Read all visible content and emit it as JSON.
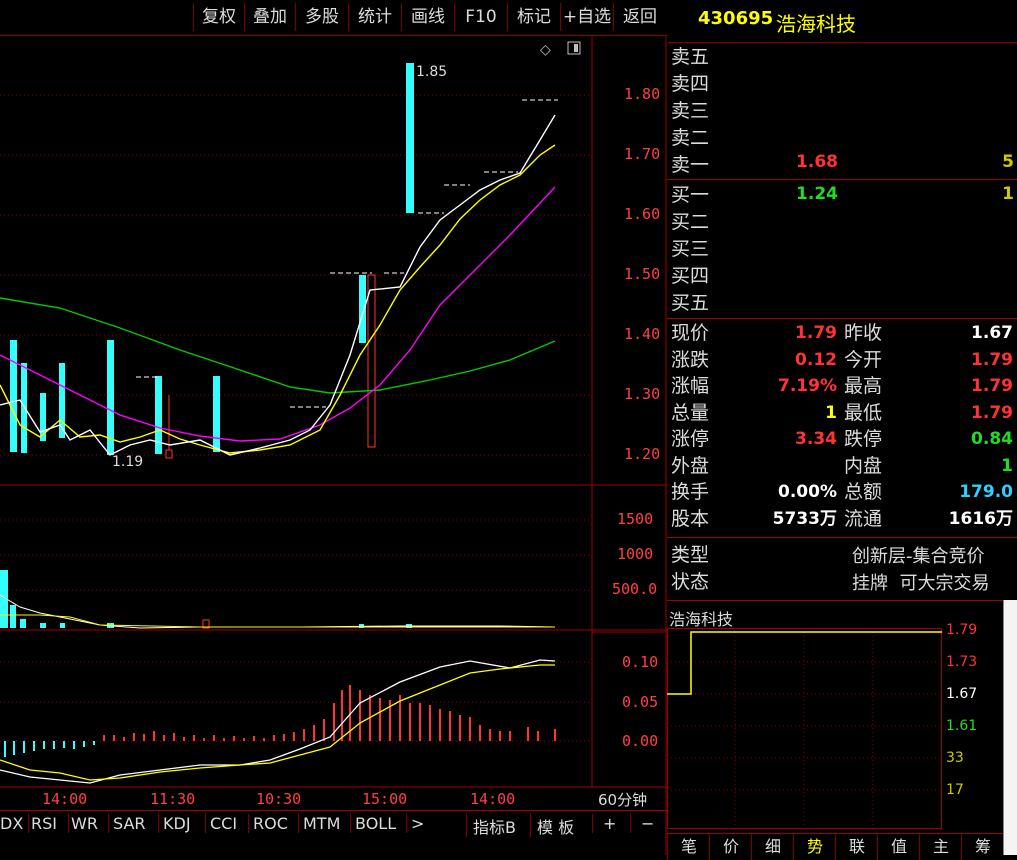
{
  "toolbar": {
    "buttons": [
      "复权",
      "叠加",
      "多股",
      "统计",
      "画线",
      "F10",
      "标记",
      "+自选",
      "返回"
    ]
  },
  "stock": {
    "code": "430695",
    "name": "浩海科技"
  },
  "order_book": {
    "asks": [
      {
        "label": "卖五",
        "price": "",
        "vol": ""
      },
      {
        "label": "卖四",
        "price": "",
        "vol": ""
      },
      {
        "label": "卖三",
        "price": "",
        "vol": ""
      },
      {
        "label": "卖二",
        "price": "",
        "vol": ""
      },
      {
        "label": "卖一",
        "price": "1.68",
        "vol": "5"
      }
    ],
    "bids": [
      {
        "label": "买一",
        "price": "1.24",
        "vol": "1"
      },
      {
        "label": "买二",
        "price": "",
        "vol": ""
      },
      {
        "label": "买三",
        "price": "",
        "vol": ""
      },
      {
        "label": "买四",
        "price": "",
        "vol": ""
      },
      {
        "label": "买五",
        "price": "",
        "vol": ""
      }
    ]
  },
  "quote": {
    "rows": [
      {
        "l1": "现价",
        "v1": "1.79",
        "c1": "red",
        "l2": "昨收",
        "v2": "1.67",
        "c2": "white"
      },
      {
        "l1": "涨跌",
        "v1": "0.12",
        "c1": "red",
        "l2": "今开",
        "v2": "1.79",
        "c2": "red"
      },
      {
        "l1": "涨幅",
        "v1": "7.19%",
        "c1": "red",
        "l2": "最高",
        "v2": "1.79",
        "c2": "red"
      },
      {
        "l1": "总量",
        "v1": "1",
        "c1": "yellow",
        "l2": "最低",
        "v2": "1.79",
        "c2": "red"
      },
      {
        "l1": "涨停",
        "v1": "3.34",
        "c1": "red",
        "l2": "跌停",
        "v2": "0.84",
        "c2": "green"
      },
      {
        "l1": "外盘",
        "v1": "",
        "c1": "red",
        "l2": "内盘",
        "v2": "1",
        "c2": "green"
      },
      {
        "l1": "换手",
        "v1": "0.00%",
        "c1": "white",
        "l2": "总额",
        "v2": "179.0",
        "c2": "cyan"
      },
      {
        "l1": "股本",
        "v1": "5733万",
        "c1": "white",
        "l2": "流通",
        "v2": "1616万",
        "c2": "white"
      }
    ],
    "type_label": "类型",
    "type_value": "创新层-集合竞价",
    "status_label": "状态",
    "status_value": "挂牌  可大宗交易"
  },
  "mini_chart": {
    "title": "浩海科技",
    "levels": [
      "1.79",
      "1.73",
      "1.67",
      "1.61",
      "33",
      "17"
    ]
  },
  "bottom_tabs": [
    "笔",
    "价",
    "细",
    "势",
    "联",
    "值",
    "主",
    "筹"
  ],
  "chart_data": {
    "type": "line",
    "price_axis": [
      "1.80",
      "1.70",
      "1.60",
      "1.50",
      "1.40",
      "1.30",
      "1.20"
    ],
    "volume_axis": [
      "1500",
      "1000",
      "500.0"
    ],
    "macd_axis": [
      "0.10",
      "0.05",
      "0.00"
    ],
    "time_axis": [
      "14:00",
      "11:30",
      "10:30",
      "15:00",
      "14:00"
    ],
    "period": "60分钟",
    "annotations": {
      "high": "1.85",
      "low": "1.19"
    },
    "ylim": [
      1.17,
      1.87
    ]
  },
  "indicator_tabs": [
    "DX",
    "RSI",
    "WR",
    "SAR",
    "KDJ",
    "CCI",
    "ROC",
    "MTM",
    "BOLL"
  ],
  "indicator_controls": {
    "more": ">",
    "index_b": "指标B",
    "template": "模 板",
    "plus": "+",
    "minus": "−"
  },
  "colors": {
    "up": "#ff3333",
    "down": "#33ffff",
    "ma1": "#ffffff",
    "ma2": "#ffff00",
    "ma3": "#ff00ff",
    "ma4": "#00cc00",
    "grid": "#a00000"
  }
}
